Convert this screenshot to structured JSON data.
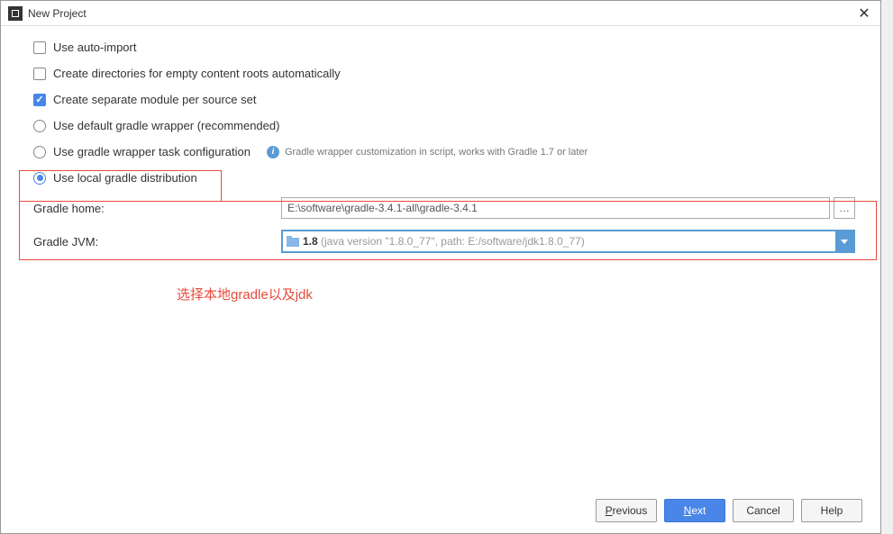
{
  "title": "New Project",
  "options": {
    "auto_import": "Use auto-import",
    "create_dirs": "Create directories for empty content roots automatically",
    "separate_module": "Create separate module per source set",
    "default_wrapper": "Use default gradle wrapper (recommended)",
    "wrapper_task": "Use gradle wrapper task configuration",
    "wrapper_hint": "Gradle wrapper customization in script, works with Gradle 1.7 or later",
    "local_dist": "Use local gradle distribution"
  },
  "form": {
    "gradle_home_label": "Gradle home:",
    "gradle_home_value": "E:\\software\\gradle-3.4.1-all\\gradle-3.4.1",
    "gradle_jvm_label": "Gradle JVM:",
    "jvm_version": "1.8",
    "jvm_details": " (java version \"1.8.0_77\", path: E:/software/jdk1.8.0_77)"
  },
  "annotation": "选择本地gradle以及jdk",
  "buttons": {
    "previous": "Previous",
    "next": "Next",
    "cancel": "Cancel",
    "help": "Help"
  },
  "browse_label": "…"
}
